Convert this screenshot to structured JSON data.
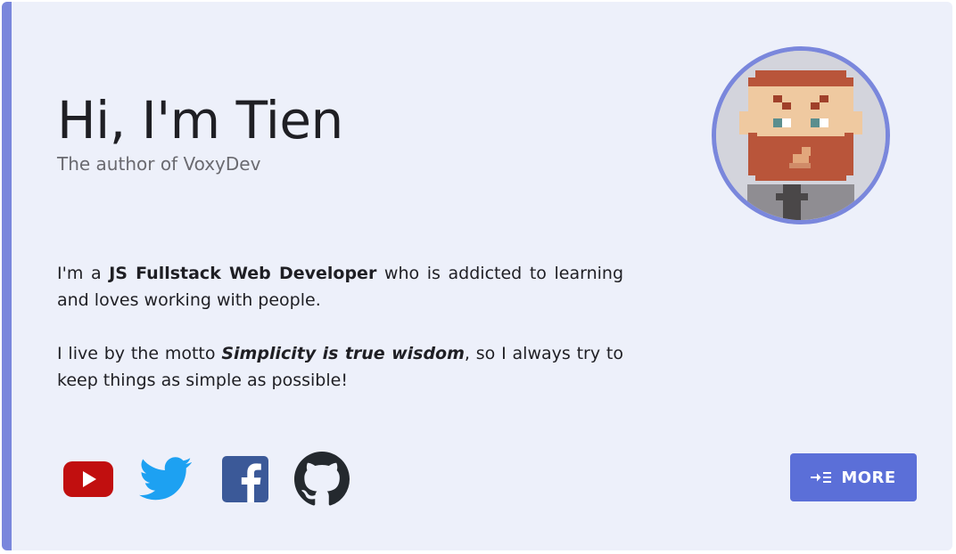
{
  "hero": {
    "title": "Hi, I'm Tien",
    "subtitle": "The author of VoxyDev"
  },
  "bio": {
    "p1_before": "I'm a ",
    "p1_bold": "JS Fullstack Web Developer",
    "p1_after": " who is addicted to learning and loves working with people.",
    "p2_before": "I live by the motto ",
    "p2_bold_italic": "Simplicity is true wisdom",
    "p2_after": ", so I always try to keep things as simple as possible!"
  },
  "avatar": {
    "icon": "pixel-art-avatar",
    "border_color": "#7a87dc"
  },
  "social": [
    {
      "name": "youtube",
      "icon": "youtube-icon",
      "color": "#cc0000"
    },
    {
      "name": "twitter",
      "icon": "twitter-icon",
      "color": "#1da1f2"
    },
    {
      "name": "facebook",
      "icon": "facebook-icon",
      "color": "#3b5998"
    },
    {
      "name": "github",
      "icon": "github-icon",
      "color": "#24292e"
    }
  ],
  "more_button": {
    "label": "MORE",
    "icon": "indent-list-icon",
    "color": "#5b6fd8"
  },
  "colors": {
    "accent": "#7a87dc",
    "card_bg": "#edf0fa"
  }
}
